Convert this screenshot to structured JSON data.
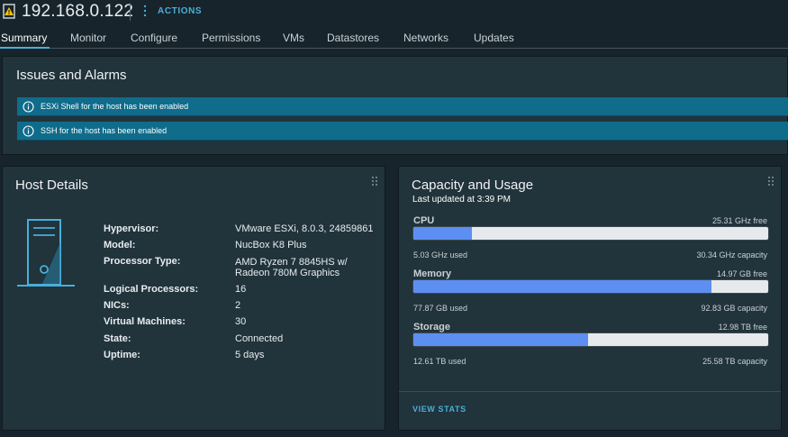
{
  "header": {
    "host_name": "192.168.0.122",
    "actions_label": "ACTIONS"
  },
  "tabs": [
    {
      "label": "Summary",
      "active": true
    },
    {
      "label": "Monitor"
    },
    {
      "label": "Configure"
    },
    {
      "label": "Permissions"
    },
    {
      "label": "VMs"
    },
    {
      "label": "Datastores"
    },
    {
      "label": "Networks"
    },
    {
      "label": "Updates"
    }
  ],
  "issues": {
    "title": "Issues and Alarms",
    "alerts": [
      {
        "text": "ESXi Shell for the host has been enabled",
        "icon": "info-icon"
      },
      {
        "text": "SSH for the host has been enabled",
        "icon": "info-icon"
      }
    ]
  },
  "host_details": {
    "title": "Host Details",
    "rows": [
      {
        "label": "Hypervisor:",
        "value": "VMware ESXi, 8.0.3, 24859861"
      },
      {
        "label": "Model:",
        "value": "NucBox K8 Plus"
      },
      {
        "label": "Processor Type:",
        "value": "AMD Ryzen 7 8845HS w/ Radeon 780M Graphics"
      },
      {
        "label": "Logical Processors:",
        "value": "16"
      },
      {
        "label": "NICs:",
        "value": "2"
      },
      {
        "label": "Virtual Machines:",
        "value": "30"
      },
      {
        "label": "State:",
        "value": "Connected"
      },
      {
        "label": "Uptime:",
        "value": "5 days"
      }
    ]
  },
  "capacity": {
    "title": "Capacity and Usage",
    "last_updated": "Last updated at 3:39 PM",
    "resources": [
      {
        "name": "CPU",
        "free": "25.31 GHz free",
        "used": "5.03 GHz used",
        "capacity": "30.34 GHz capacity",
        "fraction": 0.166
      },
      {
        "name": "Memory",
        "free": "14.97 GB free",
        "used": "77.87 GB used",
        "capacity": "92.83 GB capacity",
        "fraction": 0.839
      },
      {
        "name": "Storage",
        "free": "12.98 TB free",
        "used": "12.61 TB used",
        "capacity": "25.58 TB capacity",
        "fraction": 0.493
      }
    ],
    "view_stats_label": "VIEW STATS"
  },
  "colors": {
    "accent": "#49afd9",
    "alert_bg": "#0f6c8b",
    "bar_fill": "#5c8ff1",
    "card_bg": "#21333b"
  }
}
